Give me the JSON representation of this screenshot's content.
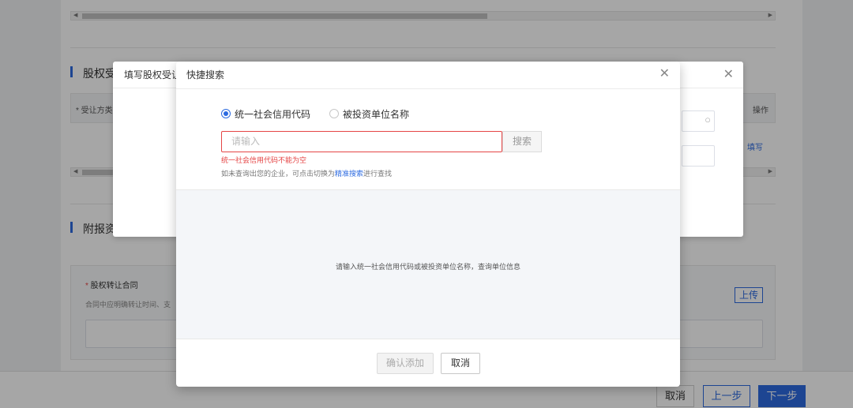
{
  "background": {
    "section_equity_title": "股权受",
    "section_attach_title": "附报资",
    "table_header_left": "* 受让方类",
    "table_header_operation": "操作",
    "fill_link": "填写",
    "contract_title": "股权转让合同",
    "contract_desc": "合同中应明确转让时间、支",
    "upload_label": "上传"
  },
  "first_dialog": {
    "title": "填写股权受让"
  },
  "quick_search": {
    "title": "快捷搜索",
    "radio_options": [
      "统一社会信用代码",
      "被投资单位名称"
    ],
    "selected_option": "统一社会信用代码",
    "input_placeholder": "请输入",
    "search_button": "搜索",
    "error_text": "统一社会信用代码不能为空",
    "hint_prefix": "如未查询出您的企业，可点击切换为",
    "hint_link": "精准搜索",
    "hint_suffix": "进行查找",
    "empty_message": "请输入统一社会信用代码或被投资单位名称，查询单位信息",
    "confirm_button": "确认添加",
    "cancel_button": "取消"
  },
  "footer": {
    "cancel": "取消",
    "prev": "上一步",
    "next": "下一步"
  },
  "colors": {
    "accent": "#2d6be0",
    "error": "#e54545"
  }
}
